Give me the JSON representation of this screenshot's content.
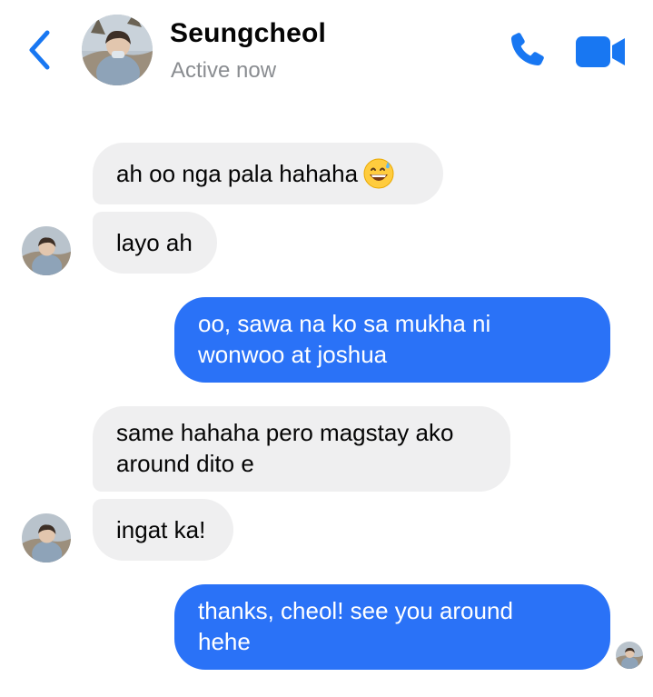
{
  "header": {
    "contact_name": "Seungcheol",
    "status": "Active now",
    "back_icon": "chevron-left-icon",
    "call_icon": "phone-icon",
    "video_icon": "video-camera-icon",
    "accent_color": "#1877f2"
  },
  "colors": {
    "incoming_bubble": "#efeff0",
    "outgoing_bubble": "#2a72f7",
    "status_text": "#8a8d91"
  },
  "messages": [
    {
      "direction": "incoming",
      "text": "ah oo nga pala hahaha",
      "emoji": "grinning-face-with-sweat"
    },
    {
      "direction": "incoming",
      "text": "layo ah"
    },
    {
      "direction": "outgoing",
      "line1": "oo, sawa na ko sa mukha ni",
      "line2": "wonwoo at joshua"
    },
    {
      "direction": "incoming",
      "line1": "same hahaha pero magstay ako",
      "line2": "around dito e"
    },
    {
      "direction": "incoming",
      "text": "ingat ka!"
    },
    {
      "direction": "outgoing",
      "line1": "thanks, cheol! see you around",
      "line2": "hehe"
    }
  ]
}
